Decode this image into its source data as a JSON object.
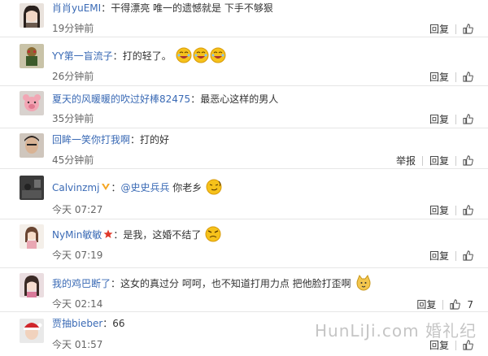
{
  "comments": [
    {
      "user": "肖肖yuEMI",
      "content": "干得漂亮 唯一的遗憾就是 下手不够狠",
      "time": "19分钟前",
      "actions": [
        "回复"
      ],
      "avatar": "avatar-woman-dark-hair"
    },
    {
      "user": "YY第一盲流子",
      "content": "打的轻了。",
      "time": "26分钟前",
      "actions": [
        "回复"
      ],
      "emoji_count": 3,
      "avatar": "avatar-cartoon"
    },
    {
      "user": "夏天的风暖暖的吹过好棒82475",
      "content": "最恶心这样的男人",
      "time": "35分钟前",
      "actions": [
        "回复"
      ],
      "avatar": "avatar-pig"
    },
    {
      "user": "回眸一笑你打我啊",
      "content": "打的好",
      "time": "45分钟前",
      "actions": [
        "举报",
        "回复"
      ],
      "avatar": "avatar-man"
    },
    {
      "user": "Calvinzmj",
      "verified": true,
      "mention": "@史史兵兵",
      "content": "你老乡",
      "time": "今天 07:27",
      "actions": [
        "回复"
      ],
      "avatar": "avatar-dark-room"
    },
    {
      "user": "NyMin敏敏",
      "star_badge": true,
      "content": "是我，这婚不结了",
      "time": "今天 07:19",
      "actions": [
        "回复"
      ],
      "avatar": "avatar-girl-cartoon"
    },
    {
      "user": "我的鸡巴断了",
      "content": "这女的真过分 呵呵，也不知道打用力点 把他脸打歪啊",
      "time": "今天 02:14",
      "actions": [
        "回复"
      ],
      "like_count": "7",
      "avatar": "avatar-girl-pink"
    },
    {
      "user": "贾抽bieber",
      "content": "66",
      "time": "今天 01:57",
      "actions": [
        "回复"
      ],
      "avatar": "avatar-santa"
    }
  ],
  "watermark": "HunLiJi.com 婚礼纪",
  "colors": {
    "username": "#3a6ab5",
    "text": "#333333",
    "time": "#666666",
    "divider": "#e6e6e6"
  }
}
